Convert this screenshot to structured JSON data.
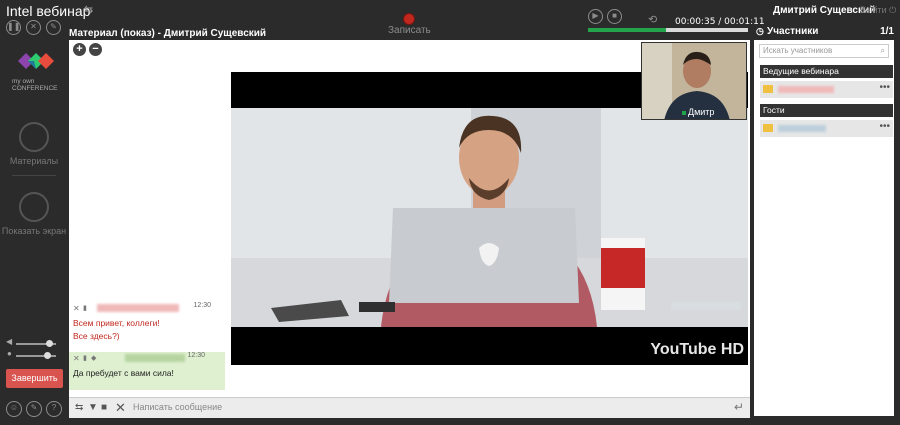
{
  "header": {
    "app_title": "Intel вебинар",
    "record_label": "Записать",
    "timer": "00:00:35 / 00:01:11",
    "progress": 0.49,
    "username": "Дмитрий Сущевский",
    "logout_label": "Выйти",
    "accent_color": "#23a44a",
    "record_color": "#c0281f"
  },
  "sidebar": {
    "logo_text_line1": "my own",
    "logo_text_line2": "CONFERENCE",
    "materials_label": "Материалы",
    "share_screen_label": "Показать экран",
    "finish_label": "Завершить"
  },
  "material": {
    "title": "Материал (показ) - Дмитрий Сущевский",
    "webcam_name": "Дмитр",
    "video_brand": "YouTube HD"
  },
  "chat": {
    "messages": [
      {
        "time": "12:30",
        "lines": [
          "Всем привет, коллеги!",
          "Все здесь?)"
        ],
        "text_color": "#c0281f",
        "background": "#ffffff"
      },
      {
        "time": "12:30",
        "lines": [
          "Да пребудет с вами сила!"
        ],
        "text_color": "#222222",
        "background": "#dff0d0"
      }
    ],
    "input_placeholder": "Написать сообщение"
  },
  "participants": {
    "title": "Участники",
    "count": "1/1",
    "search_placeholder": "Искать участников",
    "hosts_label": "Ведущие вебинара",
    "guests_label": "Гости"
  }
}
